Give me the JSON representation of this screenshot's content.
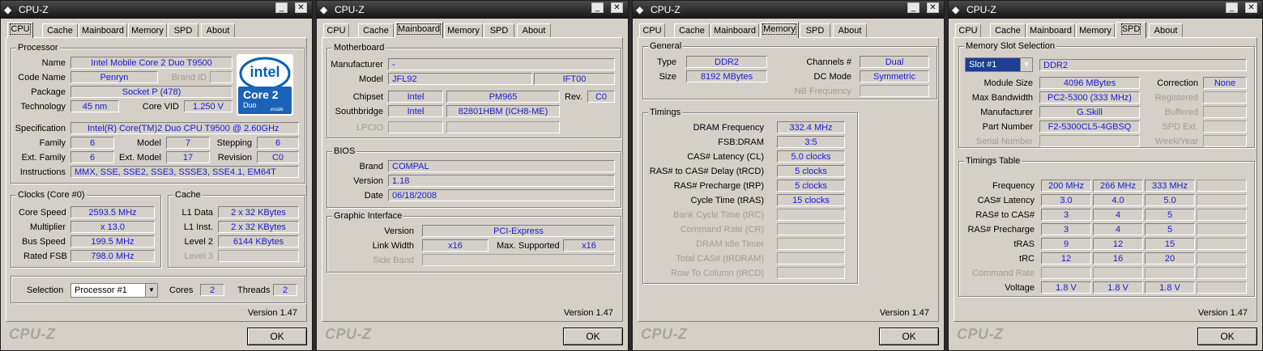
{
  "app_title": "CPU-Z",
  "tabs": [
    "CPU",
    "Cache",
    "Mainboard",
    "Memory",
    "SPD",
    "About"
  ],
  "version": "Version 1.47",
  "brand": "CPU-Z",
  "ok": "OK",
  "cpu": {
    "processor_title": "Processor",
    "name_label": "Name",
    "name": "Intel Mobile Core 2 Duo T9500",
    "codename_label": "Code Name",
    "codename": "Penryn",
    "brandid_label": "Brand ID",
    "package_label": "Package",
    "package": "Socket P (478)",
    "technology_label": "Technology",
    "technology": "45 nm",
    "corevid_label": "Core VID",
    "corevid": "1.250 V",
    "spec_label": "Specification",
    "spec": "Intel(R) Core(TM)2 Duo CPU     T9500  @ 2.60GHz",
    "family_label": "Family",
    "family": "6",
    "model_label": "Model",
    "model": "7",
    "stepping_label": "Stepping",
    "stepping": "6",
    "extfamily_label": "Ext. Family",
    "extfamily": "6",
    "extmodel_label": "Ext. Model",
    "extmodel": "17",
    "revision_label": "Revision",
    "revision": "C0",
    "instructions_label": "Instructions",
    "instructions": "MMX, SSE, SSE2, SSE3, SSSE3, SSE4.1, EM64T",
    "logo_top": "intel",
    "logo_mid": "Core 2",
    "logo_sub": "Duo",
    "logo_inside": "inside",
    "clocks_title": "Clocks (Core #0)",
    "corespeed_label": "Core Speed",
    "corespeed": "2593.5 MHz",
    "multiplier_label": "Multiplier",
    "multiplier": "x 13.0",
    "busspeed_label": "Bus Speed",
    "busspeed": "199.5 MHz",
    "ratedfsb_label": "Rated FSB",
    "ratedfsb": "798.0 MHz",
    "cache_title": "Cache",
    "l1data_label": "L1 Data",
    "l1data": "2 x 32 KBytes",
    "l1inst_label": "L1 Inst.",
    "l1inst": "2 x 32 KBytes",
    "level2_label": "Level 2",
    "level2": "6144 KBytes",
    "level3_label": "Level 3",
    "selection_label": "Selection",
    "selection": "Processor #1",
    "cores_label": "Cores",
    "cores": "2",
    "threads_label": "Threads",
    "threads": "2"
  },
  "mainboard": {
    "motherboard_title": "Motherboard",
    "manufacturer_label": "Manufacturer",
    "manufacturer": "-",
    "model_label": "Model",
    "model": "JFL92",
    "model_rev": "IFT00",
    "chipset_label": "Chipset",
    "chipset_vendor": "Intel",
    "chipset": "PM965",
    "rev_label": "Rev.",
    "rev": "C0",
    "southbridge_label": "Southbridge",
    "southbridge_vendor": "Intel",
    "southbridge": "82801HBM (ICH8-ME)",
    "lpcio_label": "LPCIO",
    "bios_title": "BIOS",
    "brand_label": "Brand",
    "brand": "COMPAL",
    "version_label": "Version",
    "version": "1.18",
    "date_label": "Date",
    "date": "06/18/2008",
    "graphic_title": "Graphic Interface",
    "gversion_label": "Version",
    "gversion": "PCI-Express",
    "linkwidth_label": "Link Width",
    "linkwidth": "x16",
    "maxsupported_label": "Max. Supported",
    "maxsupported": "x16",
    "sideband_label": "Side Band"
  },
  "memory": {
    "general_title": "General",
    "type_label": "Type",
    "type": "DDR2",
    "size_label": "Size",
    "size": "8192 MBytes",
    "channels_label": "Channels #",
    "channels": "Dual",
    "dcmode_label": "DC Mode",
    "dcmode": "Symmetric",
    "nbfreq_label": "NB Frequency",
    "timings_title": "Timings",
    "dramfreq_label": "DRAM Frequency",
    "dramfreq": "332.4 MHz",
    "fsbdram_label": "FSB:DRAM",
    "fsbdram": "3:5",
    "cl_label": "CAS# Latency (CL)",
    "cl": "5.0 clocks",
    "trcd_label": "RAS# to CAS# Delay (tRCD)",
    "trcd": "5 clocks",
    "trp_label": "RAS# Precharge (tRP)",
    "trp": "5 clocks",
    "tras_label": "Cycle Time (tRAS)",
    "tras": "15 clocks",
    "trc_label": "Bank Cycle Time (tRC)",
    "cr_label": "Command Rate (CR)",
    "idle_label": "DRAM Idle Timer",
    "trdram_label": "Total CAS# (tRDRAM)",
    "trcd2_label": "Row To Column (tRCD)"
  },
  "spd": {
    "slot_title": "Memory Slot Selection",
    "slot": "Slot #1",
    "slot_type": "DDR2",
    "modulesize_label": "Module Size",
    "modulesize": "4096 MBytes",
    "correction_label": "Correction",
    "correction": "None",
    "maxbw_label": "Max Bandwidth",
    "maxbw": "PC2-5300 (333 MHz)",
    "registered_label": "Registered",
    "manufacturer_label": "Manufacturer",
    "manufacturer": "G.Skill",
    "buffered_label": "Buffered",
    "partnumber_label": "Part Number",
    "partnumber": "F2-5300CL5-4GBSQ",
    "spdext_label": "SPD Ext.",
    "serial_label": "Serial Number",
    "weekyear_label": "Week/Year",
    "timings_title": "Timings Table",
    "rows": [
      {
        "label": "Frequency",
        "v": [
          "200 MHz",
          "266 MHz",
          "333 MHz",
          ""
        ],
        "dis": false
      },
      {
        "label": "CAS# Latency",
        "v": [
          "3.0",
          "4.0",
          "5.0",
          ""
        ],
        "dis": false
      },
      {
        "label": "RAS# to CAS#",
        "v": [
          "3",
          "4",
          "5",
          ""
        ],
        "dis": false
      },
      {
        "label": "RAS# Precharge",
        "v": [
          "3",
          "4",
          "5",
          ""
        ],
        "dis": false
      },
      {
        "label": "tRAS",
        "v": [
          "9",
          "12",
          "15",
          ""
        ],
        "dis": false
      },
      {
        "label": "tRC",
        "v": [
          "12",
          "16",
          "20",
          ""
        ],
        "dis": false
      },
      {
        "label": "Command Rate",
        "v": [
          "",
          "",
          "",
          ""
        ],
        "dis": true
      },
      {
        "label": "Voltage",
        "v": [
          "1.8 V",
          "1.8 V",
          "1.8 V",
          ""
        ],
        "dis": false
      }
    ]
  }
}
